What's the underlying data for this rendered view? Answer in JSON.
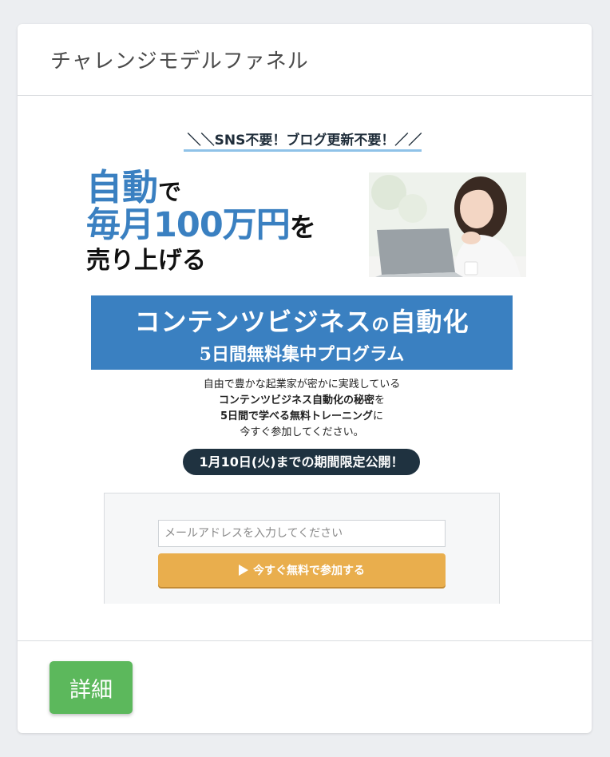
{
  "card": {
    "title": "チャレンジモデルファネル",
    "detail_button": "詳細"
  },
  "landing": {
    "tagline": "＼＼SNS不要！ブログ更新不要！／／",
    "hero": {
      "line1_main": "自動",
      "line1_suffix": "で",
      "line2_main": "毎月100万円",
      "line2_suffix": "を",
      "line3": "売り上げる"
    },
    "banner": {
      "line1_a": "コンテンツビジネス",
      "line1_b": "の",
      "line1_c": "自動化",
      "line2": "5日間無料集中プログラム"
    },
    "description": {
      "line1": "自由で豊かな起業家が密かに実践している",
      "line2_bold": "コンテンツビジネス自動化の秘密",
      "line2_tail": "を",
      "line3_bold": "5日間で学べる無料トレーニング",
      "line3_tail": "に",
      "line4": "今すぐ参加してください。"
    },
    "deadline": "1月10日(火)までの期間限定公開！",
    "form": {
      "email_placeholder": "メールアドレスを入力してください",
      "cta_label": "今すぐ無料で参加する"
    }
  },
  "colors": {
    "accent_blue": "#3a80c1",
    "cta_orange": "#e9ae4d",
    "button_green": "#5cb85c",
    "dark_navy": "#1f3240"
  }
}
